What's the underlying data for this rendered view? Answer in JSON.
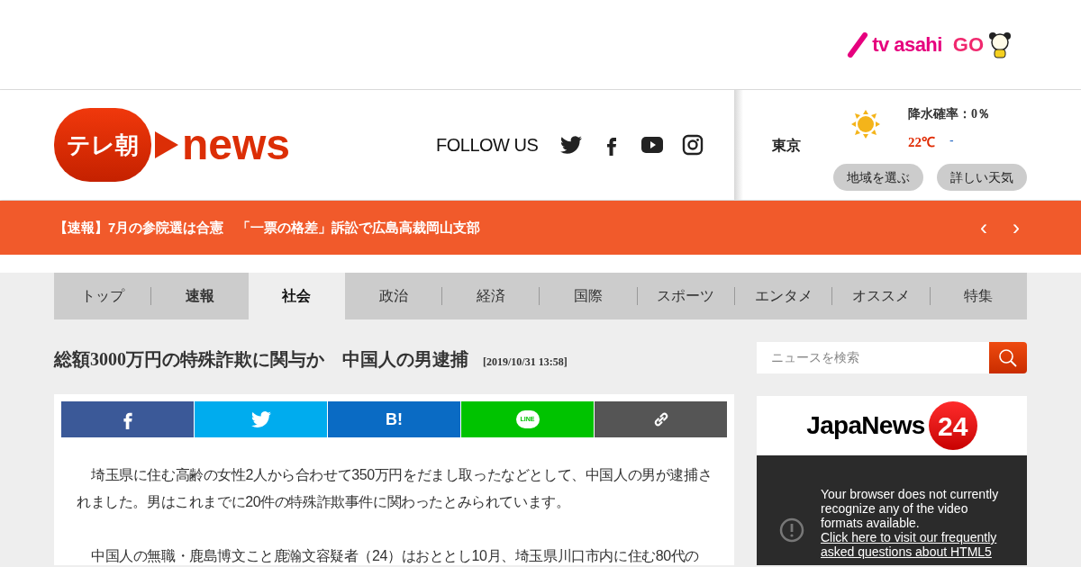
{
  "top_bar": {
    "brand_text": "tv asahi",
    "brand_badge": "GO"
  },
  "header": {
    "logo_text": "テレ朝",
    "logo_word": "news",
    "follow_label": "FOLLOW US",
    "social": [
      {
        "kind": "twitter"
      },
      {
        "kind": "facebook"
      },
      {
        "kind": "youtube"
      },
      {
        "kind": "instagram"
      }
    ]
  },
  "weather": {
    "city": "東京",
    "precip": "降水確率：0％",
    "temp": "22℃",
    "temp_low": "-",
    "buttons": [
      "地域を選ぶ",
      "詳しい天気"
    ]
  },
  "ticker": {
    "text": "【速報】7月の参院選は合憲　「一票の格差」訴訟で広島高裁岡山支部",
    "prev": "‹",
    "next": "›"
  },
  "tabs": [
    {
      "label": "トップ",
      "selected": false,
      "emphasized": false
    },
    {
      "label": "速報",
      "selected": false,
      "emphasized": true
    },
    {
      "label": "社会",
      "selected": true,
      "emphasized": false
    },
    {
      "label": "政治",
      "selected": false,
      "emphasized": false
    },
    {
      "label": "経済",
      "selected": false,
      "emphasized": false
    },
    {
      "label": "国際",
      "selected": false,
      "emphasized": false
    },
    {
      "label": "スポーツ",
      "selected": false,
      "emphasized": false
    },
    {
      "label": "エンタメ",
      "selected": false,
      "emphasized": false
    },
    {
      "label": "オススメ",
      "selected": false,
      "emphasized": false
    },
    {
      "label": "特集",
      "selected": false,
      "emphasized": false
    }
  ],
  "article": {
    "title": "総額3000万円の特殊詐欺に関与か　中国人の男逮捕",
    "date": "[2019/10/31 13:58]",
    "share": [
      {
        "kind": "facebook"
      },
      {
        "kind": "twitter"
      },
      {
        "kind": "hatena",
        "label": "B!"
      },
      {
        "kind": "line",
        "label": "LINE"
      },
      {
        "kind": "link"
      }
    ],
    "paragraphs": [
      "埼玉県に住む高齢の女性2人から合わせて350万円をだまし取ったなどとして、中国人の男が逮捕されました。男はこれまでに20件の特殊詐欺事件に関わったとみられています。",
      "中国人の無職・鹿島博文こと鹿瀚文容疑者（24）はおととし10月、埼玉県川口市内に住む80代の"
    ]
  },
  "sidebar": {
    "search": {
      "placeholder": "ニュースを検索"
    },
    "video": {
      "brand": "JapaNews",
      "brand_number": "24",
      "message": "Your browser does not currently recognize any of the video formats available.",
      "link": "Click here to visit our frequently asked questions about HTML5"
    }
  }
}
